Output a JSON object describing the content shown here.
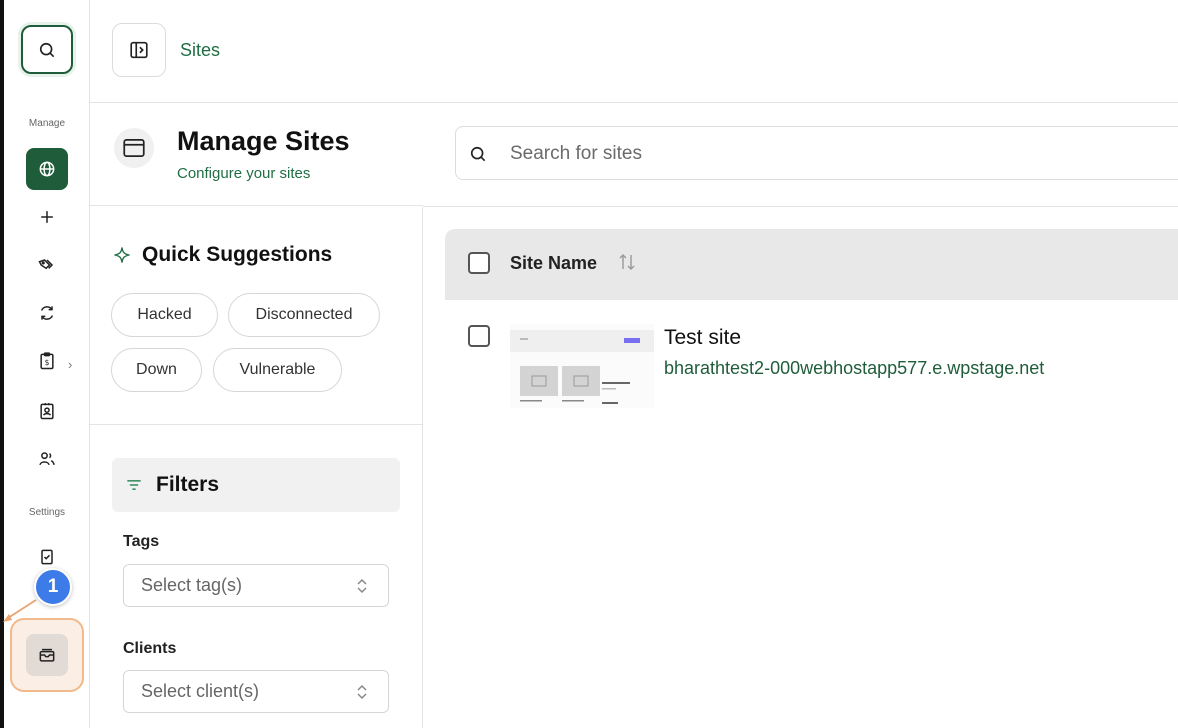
{
  "rail": {
    "section_manage": "Manage",
    "section_settings": "Settings",
    "tour_step": "1"
  },
  "topbar": {
    "breadcrumb": "Sites"
  },
  "header": {
    "title": "Manage Sites",
    "subtitle": "Configure your sites"
  },
  "search": {
    "placeholder": "Search for sites"
  },
  "quick_suggestions": {
    "title": "Quick Suggestions",
    "chips": [
      "Hacked",
      "Disconnected",
      "Down",
      "Vulnerable"
    ]
  },
  "filters": {
    "title": "Filters",
    "tags_label": "Tags",
    "tags_placeholder": "Select tag(s)",
    "clients_label": "Clients",
    "clients_placeholder": "Select client(s)"
  },
  "table": {
    "column_site_name": "Site Name",
    "rows": [
      {
        "name": "Test site",
        "url": "bharathtest2-000webhostapp577.e.wpstage.net"
      }
    ]
  },
  "colors": {
    "brand_green": "#1f5d3a",
    "link_green": "#1f6e43",
    "tour_blue": "#3d7be8",
    "tour_orange": "#f2b98a"
  }
}
